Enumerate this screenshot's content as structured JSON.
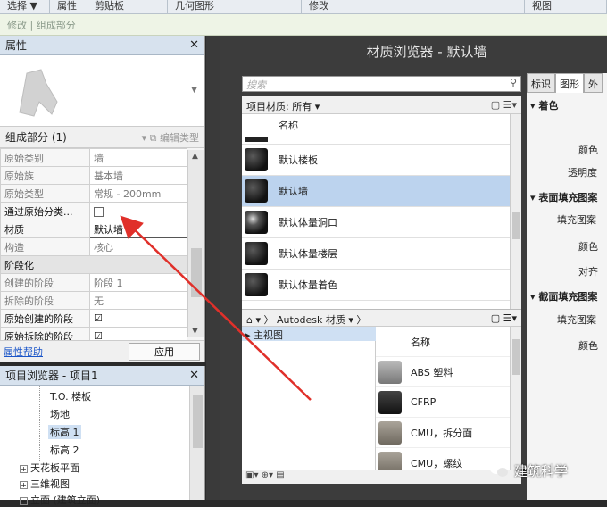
{
  "ribbon": {
    "tabs": [
      "选择 ▼",
      "属性",
      "剪贴板",
      "几何图形",
      "修改",
      "视图"
    ]
  },
  "modify_bar": {
    "text": "修改 | 组成部分"
  },
  "properties": {
    "title": "属性",
    "type_selector": "组成部分 (1)",
    "edit_type": "编辑类型",
    "rows": [
      {
        "k": "原始类别",
        "v": "墙"
      },
      {
        "k": "原始族",
        "v": "基本墙"
      },
      {
        "k": "原始类型",
        "v": "常规 - 200mm"
      },
      {
        "k": "通过原始分类...",
        "v": ""
      },
      {
        "k": "材质",
        "v": "默认墙"
      },
      {
        "k": "构造",
        "v": "核心"
      }
    ],
    "group_phase": "阶段化",
    "phase_rows": [
      {
        "k": "创建的阶段",
        "v": "阶段 1"
      },
      {
        "k": "拆除的阶段",
        "v": "无"
      },
      {
        "k": "原始创建的阶段",
        "v": "☑"
      },
      {
        "k": "原始拆除的阶段",
        "v": "☑"
      }
    ],
    "help_link": "属性帮助",
    "apply_button": "应用"
  },
  "project_browser": {
    "title": "项目浏览器 - 项目1",
    "items": [
      "T.O. 楼板",
      "场地",
      "标高 1",
      "标高 2",
      "天花板平面",
      "三维视图",
      "立面 (建筑立面)"
    ]
  },
  "material_browser": {
    "title": "材质浏览器 - 默认墙",
    "search_placeholder": "搜索",
    "project_materials": "项目材质: 所有 ▾",
    "column_name": "名称",
    "materials": [
      "默认楼板",
      "默认墙",
      "默认体量洞口",
      "默认体量楼层",
      "默认体量着色"
    ],
    "library_bar": "Autodesk 材质 ▾",
    "library_tree": "主视图",
    "library_column": "名称",
    "library_items": [
      "ABS 塑料",
      "CFRP",
      "CMU，拆分面",
      "CMU，螺纹"
    ],
    "tabs": [
      "标识",
      "图形",
      "外"
    ],
    "sections": {
      "shading": "▾ 着色",
      "surface": "▾ 表面填充图案",
      "cut": "▾ 截面填充图案"
    },
    "labels": {
      "color": "颜色",
      "transparency": "透明度",
      "fill_pattern": "填充图案",
      "color2": "颜色",
      "align": "对齐",
      "fill_pattern2": "填充图案",
      "color3": "颜色"
    }
  },
  "watermark": {
    "text": "建筑科学"
  }
}
